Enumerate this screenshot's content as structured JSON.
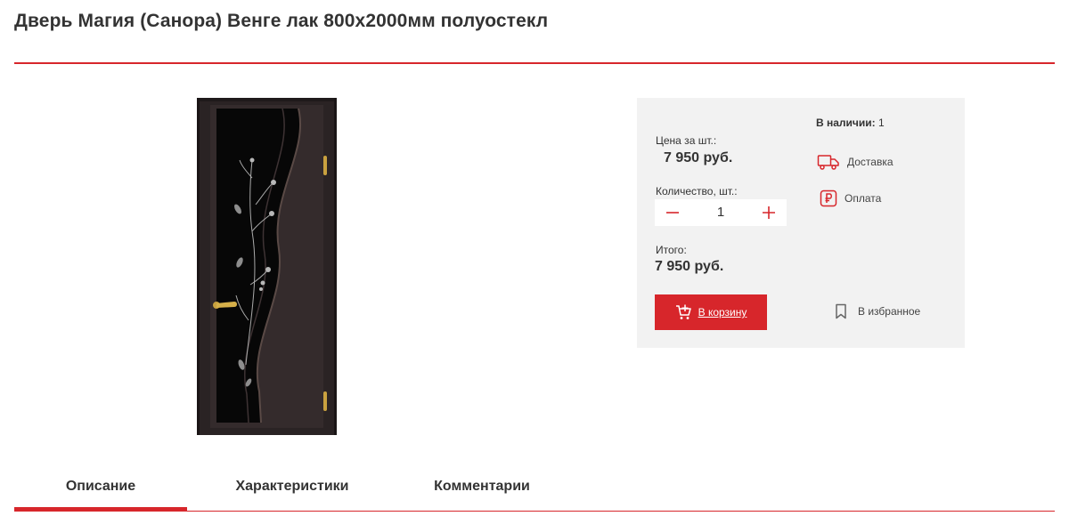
{
  "product": {
    "title": "Дверь Магия (Санора) Венге лак 800х2000мм полуостекл"
  },
  "buy_box": {
    "price_label": "Цена за шт.:",
    "price_value": "7 950 руб.",
    "quantity_label": "Количество, шт.:",
    "quantity_value": "1",
    "total_label": "Итого:",
    "total_value": "7 950 руб.",
    "cart_button_label": "В корзину",
    "stock_label": "В наличии:",
    "stock_value": "1",
    "delivery_label": "Доставка",
    "payment_label": "Оплата",
    "favorite_label": "В избранное"
  },
  "tabs": [
    {
      "label": "Описание",
      "active": true
    },
    {
      "label": "Характеристики",
      "active": false
    },
    {
      "label": "Комментарии",
      "active": false
    }
  ],
  "colors": {
    "accent": "#d7262b",
    "panel_background": "#f2f2f2",
    "text": "#333333",
    "door_wenge": "#2a2324"
  },
  "icons": {
    "cart": "cart-plus-icon",
    "delivery": "truck-icon",
    "payment": "ruble-icon",
    "favorite": "bookmark-icon",
    "minus": "minus-icon",
    "plus": "plus-icon"
  }
}
